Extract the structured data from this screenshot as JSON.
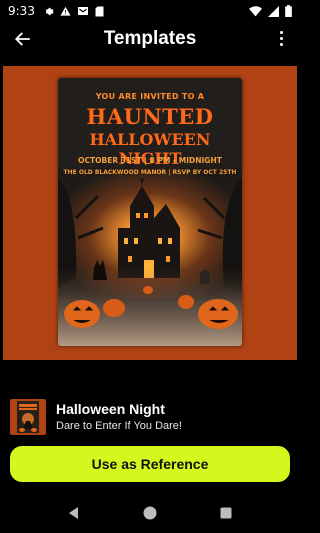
{
  "status_bar": {
    "time": "9:33",
    "left_icons": [
      "settings-icon",
      "warning-icon",
      "mail-icon",
      "sd-card-icon"
    ],
    "right_icons": [
      "wifi-icon",
      "signal-icon",
      "battery-icon"
    ]
  },
  "app_bar": {
    "title": "Templates",
    "back_icon": "arrow-left-icon",
    "more_icon": "more-vert-icon"
  },
  "preview": {
    "background": "#b04214",
    "poster": {
      "invite": "YOU ARE INVITED TO A",
      "title_line1": "HAUNTED",
      "title_line2": "HALLOWEEN NIGHT",
      "date_line": "OCTOBER 31ST | 8 PM - MIDNIGHT",
      "venue_line": "THE OLD BLACKWOOD MANOR | RSVP BY OCT 25TH"
    }
  },
  "template": {
    "name": "Halloween Night",
    "description": "Dare to Enter If You Dare!"
  },
  "actions": {
    "use_reference_label": "Use as Reference",
    "accent_color": "#d6f71d"
  },
  "nav_bar": {
    "icons": [
      "back-triangle-icon",
      "home-circle-icon",
      "recents-square-icon"
    ]
  }
}
